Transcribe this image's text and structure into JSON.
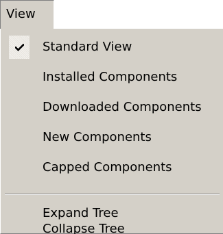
{
  "menubar": {
    "view_label": "View"
  },
  "menu": {
    "items": [
      {
        "label": "Standard View",
        "checked": true
      },
      {
        "label": "Installed Components",
        "checked": false
      },
      {
        "label": "Downloaded Components",
        "checked": false
      },
      {
        "label": "New Components",
        "checked": false
      },
      {
        "label": "Capped Components",
        "checked": false
      },
      {
        "label": "Expand Tree",
        "checked": false
      },
      {
        "label": "Collapse Tree",
        "checked": false
      }
    ],
    "check_icon": "checkmark-icon"
  },
  "colors": {
    "menu_background": "#d4d0c8",
    "text": "#000000",
    "separator_dark": "#808080",
    "separator_light": "#ffffff"
  }
}
